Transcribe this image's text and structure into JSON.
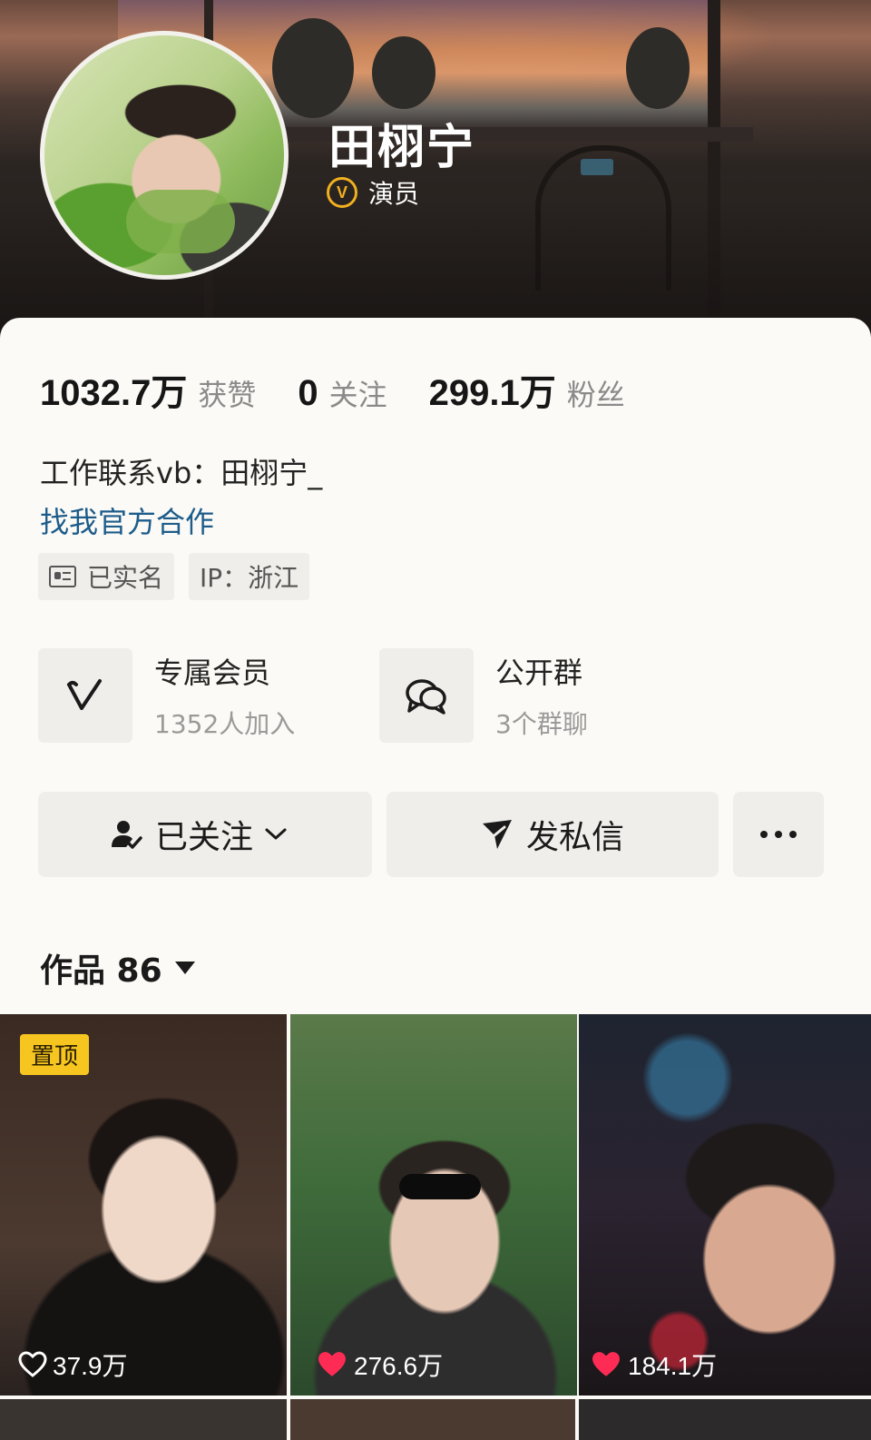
{
  "profile": {
    "name": "田栩宁",
    "verify_label": "演员",
    "verify_badge": "V"
  },
  "stats": [
    {
      "value": "1032.7万",
      "label": "获赞"
    },
    {
      "value": "0",
      "label": "关注"
    },
    {
      "value": "299.1万",
      "label": "粉丝"
    }
  ],
  "bio": "工作联系vb：田栩宁_",
  "link": "找我官方合作",
  "chips": {
    "verified": "已实名",
    "ip": "IP：浙江"
  },
  "features": [
    {
      "title": "专属会员",
      "sub": "1352人加入",
      "icon": "v-membership-icon"
    },
    {
      "title": "公开群",
      "sub": "3个群聊",
      "icon": "group-chat-icon"
    }
  ],
  "buttons": {
    "follow": "已关注",
    "message": "发私信",
    "more": "more-dots-icon"
  },
  "works": {
    "label": "作品 86"
  },
  "grid": [
    {
      "likes": "37.9万",
      "pinned": "置顶",
      "liked": false
    },
    {
      "likes": "276.6万",
      "liked": true
    },
    {
      "likes": "184.1万",
      "liked": true
    }
  ],
  "colors": {
    "accent_link": "#1d5c8a",
    "badge_gold": "#f0b020",
    "pin_yellow": "#f7c520",
    "heart_red": "#fe2c55"
  }
}
